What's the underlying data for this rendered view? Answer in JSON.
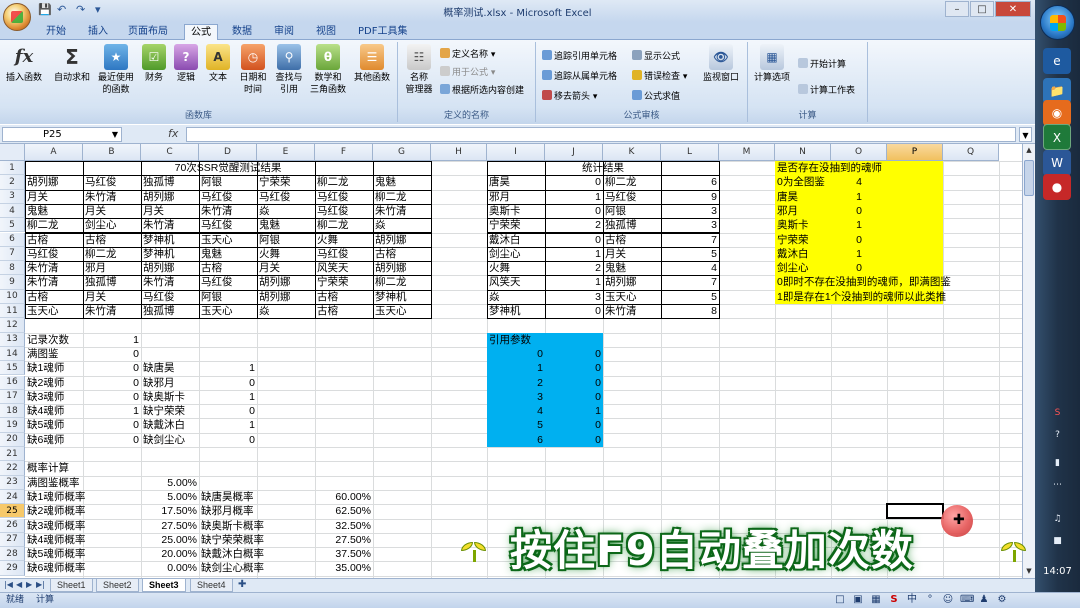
{
  "window": {
    "title": "概率测试.xlsx - Microsoft Excel"
  },
  "tabs": [
    "开始",
    "插入",
    "页面布局",
    "公式",
    "数据",
    "审阅",
    "视图",
    "PDF工具集"
  ],
  "active_tab": "公式",
  "ribbon": {
    "insert_func": "插入函数",
    "autosum": "自动求和",
    "recent": [
      "最近使用",
      "的函数"
    ],
    "finance": "财务",
    "logic": "逻辑",
    "text": "文本",
    "datetime": [
      "日期和",
      "时间"
    ],
    "lookup": [
      "查找与",
      "引用"
    ],
    "math": [
      "数学和",
      "三角函数"
    ],
    "more": "其他函数",
    "group_library": "函数库",
    "name_mgr": [
      "名称",
      "管理器"
    ],
    "define_name": "定义名称",
    "use_in_formula": "用于公式",
    "create_from_sel": "根据所选内容创建",
    "group_names": "定义的名称",
    "trace_prec": "追踪引用单元格",
    "trace_dep": "追踪从属单元格",
    "remove_arrows": "移去箭头",
    "show_formulas": "显示公式",
    "error_check": "错误检查",
    "eval_formula": "公式求值",
    "watch": "监视窗口",
    "group_audit": "公式审核",
    "calc_options": "计算选项",
    "calc_now": "开始计算",
    "calc_sheet": "计算工作表",
    "group_calc": "计算"
  },
  "formula_bar": {
    "name_box": "P25",
    "fx": "fx",
    "content": ""
  },
  "columns": [
    "A",
    "B",
    "C",
    "D",
    "E",
    "F",
    "G",
    "H",
    "I",
    "J",
    "K",
    "L",
    "M",
    "N",
    "O",
    "P",
    "Q"
  ],
  "rows": [
    "1",
    "2",
    "3",
    "4",
    "5",
    "6",
    "7",
    "8",
    "9",
    "10",
    "11",
    "12",
    "13",
    "14",
    "15",
    "16",
    "17",
    "18",
    "19",
    "20",
    "21",
    "22",
    "23",
    "24",
    "25",
    "26",
    "27",
    "28",
    "29"
  ],
  "sheet": {
    "title": "70次SSR觉醒测试结果",
    "results": [
      [
        "胡列娜",
        "马红俊",
        "独孤博",
        "阿银",
        "宁荣荣",
        "柳二龙",
        "鬼魅"
      ],
      [
        "月关",
        "朱竹清",
        "胡列娜",
        "马红俊",
        "马红俊",
        "马红俊",
        "柳二龙"
      ],
      [
        "鬼魅",
        "月关",
        "月关",
        "朱竹清",
        "焱",
        "马红俊",
        "朱竹清"
      ],
      [
        "柳二龙",
        "剑尘心",
        "朱竹清",
        "马红俊",
        "鬼魅",
        "柳二龙",
        "焱"
      ],
      [
        "古榕",
        "古榕",
        "梦神机",
        "玉天心",
        "阿银",
        "火舞",
        "胡列娜"
      ],
      [
        "马红俊",
        "柳二龙",
        "梦神机",
        "鬼魅",
        "火舞",
        "马红俊",
        "古榕"
      ],
      [
        "朱竹清",
        "邪月",
        "胡列娜",
        "古榕",
        "月关",
        "风笑天",
        "胡列娜"
      ],
      [
        "朱竹清",
        "独孤博",
        "朱竹清",
        "马红俊",
        "胡列娜",
        "宁荣荣",
        "柳二龙"
      ],
      [
        "古榕",
        "月关",
        "马红俊",
        "阿银",
        "胡列娜",
        "古榕",
        "梦神机"
      ],
      [
        "玉天心",
        "朱竹清",
        "独孤博",
        "玉天心",
        "焱",
        "古榕",
        "玉天心"
      ]
    ],
    "stats_title": "统计结果",
    "stats": [
      [
        "唐昊",
        "0",
        "柳二龙",
        "6"
      ],
      [
        "邪月",
        "1",
        "马红俊",
        "9"
      ],
      [
        "奥斯卡",
        "0",
        "阿银",
        "3"
      ],
      [
        "宁荣荣",
        "2",
        "独孤博",
        "3"
      ],
      [
        "戴沐白",
        "0",
        "古榕",
        "7"
      ],
      [
        "剑尘心",
        "1",
        "月关",
        "5"
      ],
      [
        "火舞",
        "2",
        "鬼魅",
        "4"
      ],
      [
        "风笑天",
        "1",
        "胡列娜",
        "7"
      ],
      [
        "焱",
        "3",
        "玉天心",
        "5"
      ],
      [
        "梦神机",
        "0",
        "朱竹清",
        "8"
      ]
    ],
    "yellow": [
      [
        "是否存在没抽到的魂师",
        ""
      ],
      [
        "0为全图鉴",
        "4"
      ],
      [
        "唐昊",
        "1"
      ],
      [
        "邪月",
        "0"
      ],
      [
        "奥斯卡",
        "1"
      ],
      [
        "宁荣荣",
        "0"
      ],
      [
        "戴沐白",
        "1"
      ],
      [
        "剑尘心",
        "0"
      ],
      [
        "0即时不存在没抽到的魂师，即满图鉴",
        ""
      ],
      [
        "1即是存在1个没抽到的魂师以此类推",
        ""
      ]
    ],
    "counts": [
      [
        "记录次数",
        "1",
        "",
        ""
      ],
      [
        "满图鉴",
        "0",
        "",
        ""
      ],
      [
        "缺1魂师",
        "0",
        "缺唐昊",
        "1"
      ],
      [
        "缺2魂师",
        "0",
        "缺邪月",
        "0"
      ],
      [
        "缺3魂师",
        "0",
        "缺奥斯卡",
        "1"
      ],
      [
        "缺4魂师",
        "1",
        "缺宁荣荣",
        "0"
      ],
      [
        "缺5魂师",
        "0",
        "缺戴沐白",
        "1"
      ],
      [
        "缺6魂师",
        "0",
        "缺剑尘心",
        "0"
      ]
    ],
    "ref_title": "引用参数",
    "ref": [
      [
        "0",
        "0"
      ],
      [
        "1",
        "0"
      ],
      [
        "2",
        "0"
      ],
      [
        "3",
        "0"
      ],
      [
        "4",
        "1"
      ],
      [
        "5",
        "0"
      ],
      [
        "6",
        "0"
      ]
    ],
    "prob_title": "概率计算",
    "prob": [
      [
        "满图鉴概率",
        "5.00%",
        "",
        ""
      ],
      [
        "缺1魂师概率",
        "5.00%",
        "缺唐昊概率",
        "60.00%"
      ],
      [
        "缺2魂师概率",
        "17.50%",
        "缺邪月概率",
        "62.50%"
      ],
      [
        "缺3魂师概率",
        "27.50%",
        "缺奥斯卡概率",
        "32.50%"
      ],
      [
        "缺4魂师概率",
        "25.00%",
        "缺宁荣荣概率",
        "27.50%"
      ],
      [
        "缺5魂师概率",
        "20.00%",
        "缺戴沐白概率",
        "37.50%"
      ],
      [
        "缺6魂师概率",
        "0.00%",
        "缺剑尘心概率",
        "35.00%"
      ]
    ]
  },
  "sheet_tabs": [
    "Sheet1",
    "Sheet2",
    "Sheet3",
    "Sheet4"
  ],
  "active_sheet": "Sheet3",
  "status": {
    "left1": "就绪",
    "left2": "计算"
  },
  "overlay_caption": "按住F9自动叠加次数",
  "taskbar": {
    "clock": "14:07"
  },
  "colors": {
    "yellow": "#ffff00",
    "blue": "#00b0f0",
    "banner_green": "#0d6b1a"
  }
}
